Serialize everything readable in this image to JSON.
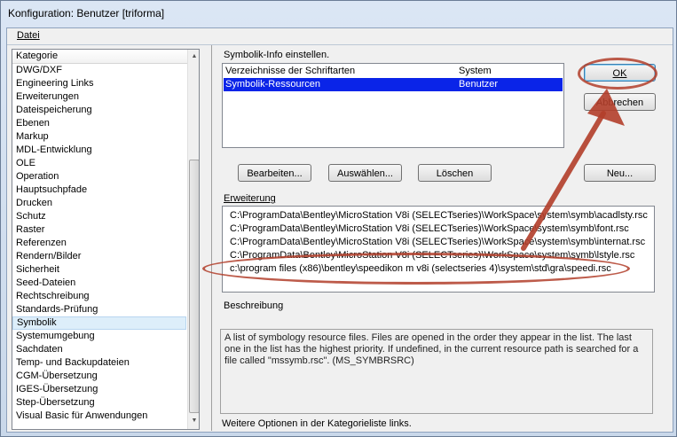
{
  "window": {
    "title": "Konfiguration: Benutzer [triforma]"
  },
  "menu": {
    "datei": "Datei"
  },
  "categories": {
    "header": "Kategorie",
    "items": [
      "DWG/DXF",
      "Engineering Links",
      "Erweiterungen",
      "Dateispeicherung",
      "Ebenen",
      "Markup",
      "MDL-Entwicklung",
      "OLE",
      "Operation",
      "Hauptsuchpfade",
      "Drucken",
      "Schutz",
      "Raster",
      "Referenzen",
      "Rendern/Bilder",
      "Sicherheit",
      "Seed-Dateien",
      "Rechtschreibung",
      "Standards-Prüfung",
      "Symbolik",
      "Systemumgebung",
      "Sachdaten",
      "Temp- und Backupdateien",
      "CGM-Übersetzung",
      "IGES-Übersetzung",
      "Step-Übersetzung",
      "Visual Basic für Anwendungen"
    ],
    "selected": "Symbolik"
  },
  "info": {
    "label": "Symbolik-Info einstellen.",
    "rows": [
      {
        "name": "Verzeichnisse der Schriftarten",
        "level": "System"
      },
      {
        "name": "Symbolik-Ressourcen",
        "level": "Benutzer"
      }
    ]
  },
  "buttons": {
    "ok": "OK",
    "abbrechen": "Abbrechen",
    "bearbeiten": "Bearbeiten...",
    "auswaehlen": "Auswählen...",
    "loeschen": "Löschen",
    "neu": "Neu..."
  },
  "erweiterung": {
    "label": "Erweiterung",
    "rows": [
      "C:\\ProgramData\\Bentley\\MicroStation V8i (SELECTseries)\\WorkSpace\\system\\symb\\acadlsty.rsc",
      "C:\\ProgramData\\Bentley\\MicroStation V8i (SELECTseries)\\WorkSpace\\system\\symb\\font.rsc",
      "C:\\ProgramData\\Bentley\\MicroStation V8i (SELECTseries)\\WorkSpace\\system\\symb\\internat.rsc",
      "C:\\ProgramData\\Bentley\\MicroStation V8i (SELECTseries)\\WorkSpace\\system\\symb\\lstyle.rsc",
      "c:\\program files (x86)\\bentley\\speedikon m v8i (selectseries 4)\\system\\std\\gra\\speedi.rsc"
    ]
  },
  "beschreibung": {
    "label": "Beschreibung",
    "text": "A list of symbology resource files. Files are opened in the order they appear in the list. The last one in the list has the highest priority. If undefined, in the current resource path is searched for a file called \"mssymb.rsc\". (MS_SYMBRSRC)"
  },
  "footer": "Weitere Optionen in der Kategorieliste links.",
  "annotation_color": "#b23e2a"
}
